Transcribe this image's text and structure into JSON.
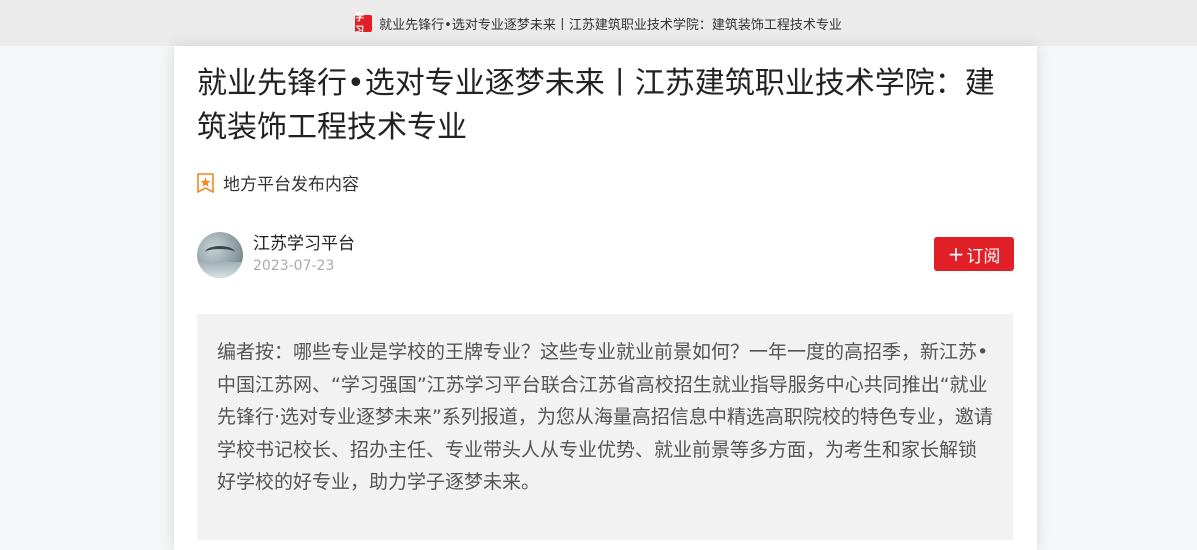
{
  "header": {
    "logo_text": "学习",
    "title": "就业先锋行•选对专业逐梦未来丨江苏建筑职业技术学院：建筑装饰工程技术专业"
  },
  "article": {
    "title": "就业先锋行•选对专业逐梦未来丨江苏建筑职业技术学院：建筑装饰工程技术专业",
    "source_label": "地方平台发布内容",
    "source_icon": "star-badge-icon",
    "author": {
      "name": "江苏学习平台",
      "date": "2023-07-23"
    },
    "subscribe_plus": "+",
    "subscribe_label": "订阅",
    "editor_note": "编者按：哪些专业是学校的王牌专业？这些专业就业前景如何？一年一度的高招季，新江苏•中国江苏网、“学习强国”江苏学习平台联合江苏省高校招生就业指导服务中心共同推出“就业先锋行·选对专业逐梦未来”系列报道，为您从海量高招信息中精选高职院校的特色专业，邀请学校书记校长、招办主任、专业带头人从专业优势、就业前景等多方面，为考生和家长解锁好学校的好专业，助力学子逐梦未来。"
  },
  "colors": {
    "accent": "#e01f26",
    "badge": "#f08a24"
  }
}
